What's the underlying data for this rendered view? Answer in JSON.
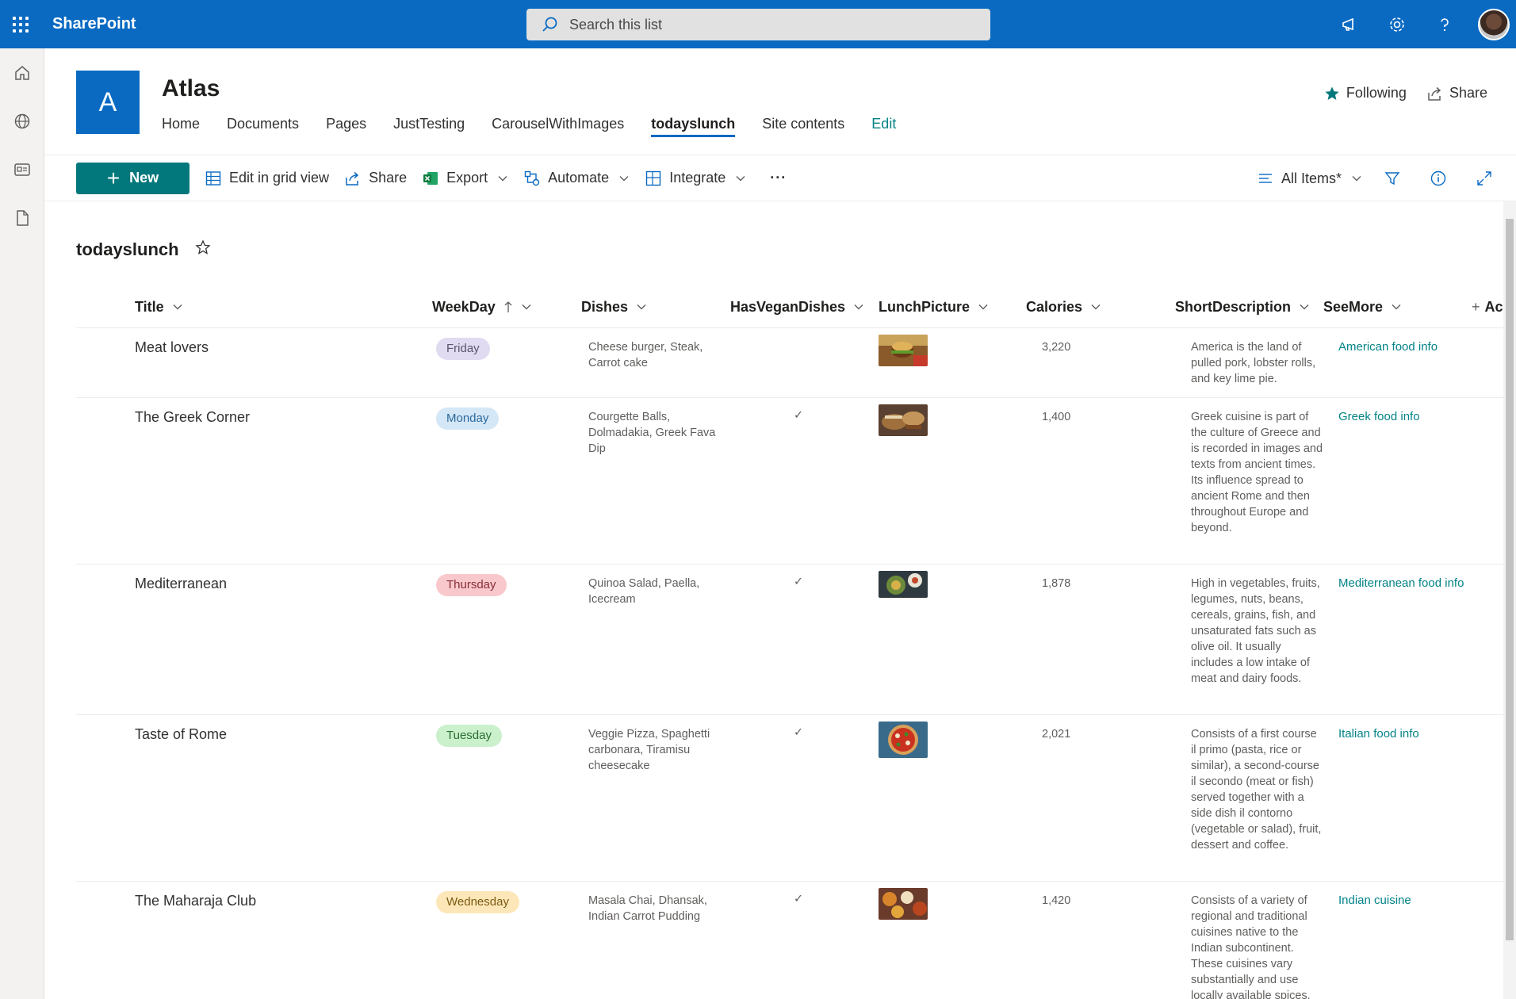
{
  "suite": {
    "brand": "SharePoint",
    "search_placeholder": "Search this list"
  },
  "site": {
    "logo_letter": "A",
    "title": "Atlas",
    "nav": [
      "Home",
      "Documents",
      "Pages",
      "JustTesting",
      "CarouselWithImages",
      "todayslunch",
      "Site contents",
      "Edit"
    ],
    "following_label": "Following",
    "share_label": "Share"
  },
  "commandbar": {
    "new_label": "New",
    "edit_grid_label": "Edit in grid view",
    "share_label": "Share",
    "export_label": "Export",
    "automate_label": "Automate",
    "integrate_label": "Integrate",
    "more_label": "···",
    "view_label": "All Items*"
  },
  "list": {
    "title": "todayslunch",
    "columns": {
      "title": "Title",
      "weekday": "WeekDay",
      "dishes": "Dishes",
      "vegan": "HasVeganDishes",
      "picture": "LunchPicture",
      "calories": "Calories",
      "desc": "ShortDescription",
      "more": "SeeMore",
      "add": "Ac"
    },
    "rows": [
      {
        "title": "Meat lovers",
        "weekday": "Friday",
        "dishes": "Cheese burger, Steak, Carrot cake",
        "vegan": "",
        "calories": "3,220",
        "desc": "America is the land of pulled pork, lobster rolls, and key lime pie.",
        "more": "American food info"
      },
      {
        "title": "The Greek Corner",
        "weekday": "Monday",
        "dishes": "Courgette Balls, Dolmadakia, Greek Fava Dip",
        "vegan": "✓",
        "calories": "1,400",
        "desc": "Greek cuisine is part of the culture of Greece and is recorded in images and texts from ancient times. Its influence spread to ancient Rome and then throughout Europe and beyond.",
        "more": "Greek food info"
      },
      {
        "title": "Mediterranean",
        "weekday": "Thursday",
        "dishes": "Quinoa Salad, Paella, Icecream",
        "vegan": "✓",
        "calories": "1,878",
        "desc": "High in vegetables, fruits, legumes, nuts, beans, cereals, grains, fish, and unsaturated fats such as olive oil. It usually includes a low intake of meat and dairy foods.",
        "more": "Mediterranean food info"
      },
      {
        "title": "Taste of Rome",
        "weekday": "Tuesday",
        "dishes": "Veggie Pizza, Spaghetti carbonara, Tiramisu cheesecake",
        "vegan": "✓",
        "calories": "2,021",
        "desc": "Consists of a first course il primo (pasta, rice or similar), a second-course il secondo (meat or fish) served together with a side dish il contorno (vegetable or salad), fruit, dessert and coffee.",
        "more": "Italian food info"
      },
      {
        "title": "The Maharaja Club",
        "weekday": "Wednesday",
        "dishes": "Masala Chai, Dhansak, Indian Carrot Pudding",
        "vegan": "✓",
        "calories": "1,420",
        "desc": "Consists of a variety of regional and traditional cuisines native to the Indian subcontinent. These cuisines vary substantially and use locally available spices,",
        "more": "Indian cuisine"
      }
    ]
  },
  "colors": {
    "suitebar": "#0a6ac2",
    "accent": "#03787c",
    "pill_friday": "#e0dbf0",
    "pill_monday": "#d4e7f6",
    "pill_thursday": "#f8c8cc",
    "pill_tuesday": "#caf0cc",
    "pill_wednesday": "#fde7b9"
  }
}
